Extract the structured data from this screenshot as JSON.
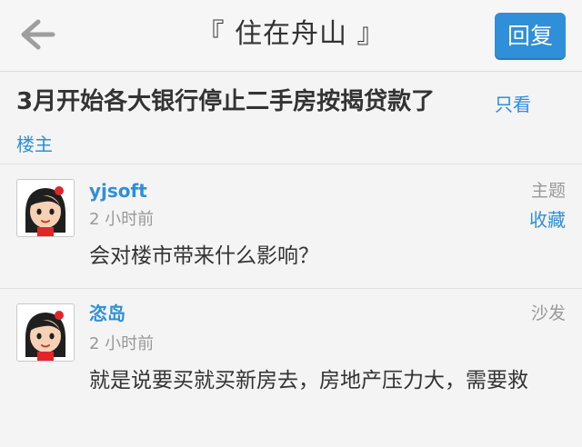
{
  "header": {
    "back_icon": "arrow-left-icon",
    "title": "『 住在舟山 』",
    "reply_label": "回复"
  },
  "thread": {
    "title": "3月开始各大银行停止二手房按揭贷款了",
    "only_op_part1": "只看",
    "only_op_part2": "楼主"
  },
  "posts": [
    {
      "author": "yjsoft",
      "time": "2 小时前",
      "floor": "主题",
      "favorite": "收藏",
      "content": "会对楼市带来什么影响？",
      "avatar_icon": "cartoon-girl-avatar"
    },
    {
      "author": "恣岛",
      "time": "2 小时前",
      "floor": "沙发",
      "content": "就是说要买就买新房去，房地产压力大，需要救",
      "avatar_icon": "cartoon-girl-avatar"
    }
  ],
  "colors": {
    "accent": "#2f8fd8",
    "background": "#f4f4f4",
    "muted": "#999999",
    "text": "#333333"
  }
}
